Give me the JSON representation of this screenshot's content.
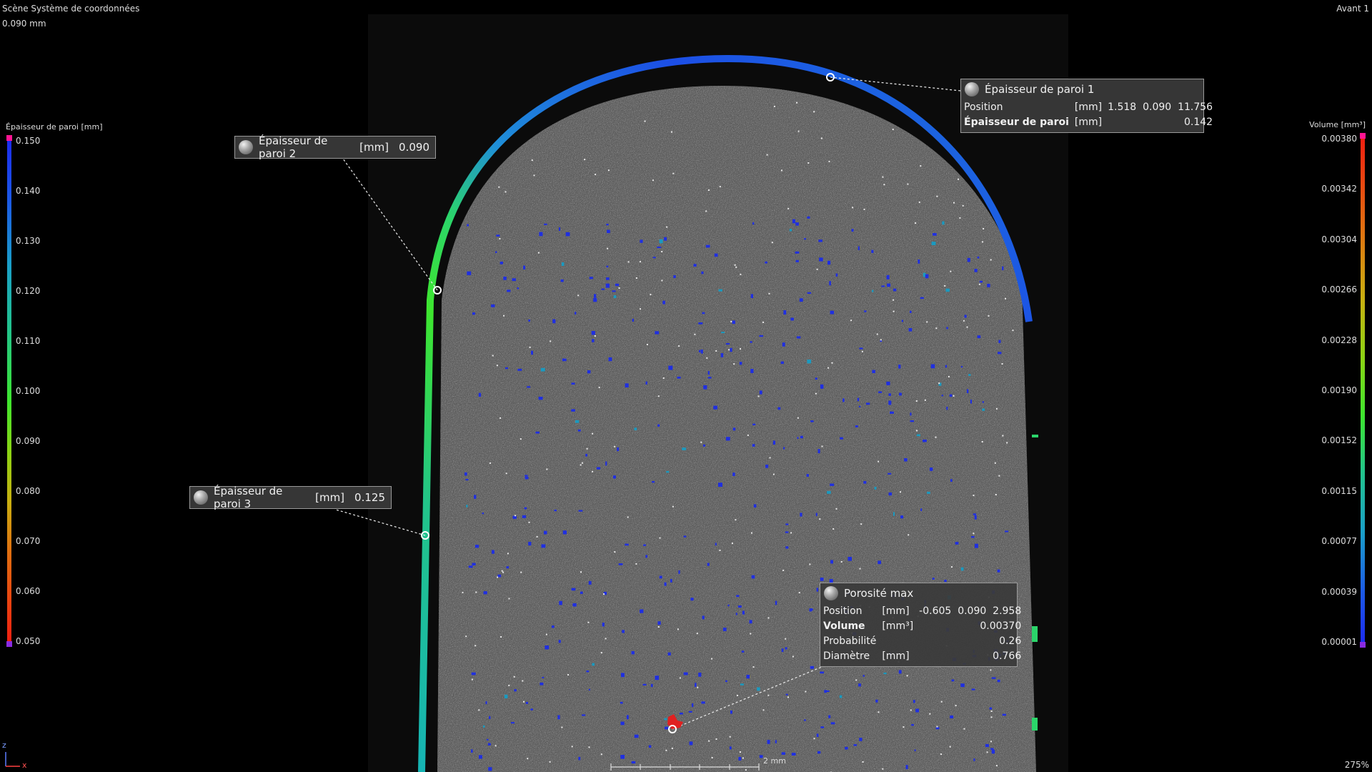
{
  "hud": {
    "scene_label": "Scène Système de coordonnées",
    "slice_value": "0.090 mm",
    "view_name": "Avant 1",
    "zoom": "275%",
    "scale_bar_label": "2 mm",
    "axis_z": "z",
    "axis_x": "x"
  },
  "left_scale": {
    "title": "Épaisseur de paroi [mm]",
    "ticks": [
      "0.150",
      "0.140",
      "0.130",
      "0.120",
      "0.110",
      "0.100",
      "0.090",
      "0.080",
      "0.070",
      "0.060",
      "0.050"
    ],
    "cap_top_color": "#ff1493",
    "cap_bottom_color": "#8a2be2"
  },
  "right_scale": {
    "title": "Volume [mm³]",
    "ticks": [
      "0.00380",
      "0.00342",
      "0.00304",
      "0.00266",
      "0.00228",
      "0.00190",
      "0.00152",
      "0.00115",
      "0.00077",
      "0.00039",
      "0.00001"
    ],
    "cap_top_color": "#ff1493",
    "cap_bottom_color": "#8a2be2"
  },
  "callouts": {
    "wall1": {
      "title": "Épaisseur de paroi 1",
      "row1_label": "Position",
      "row1_unit": "[mm]",
      "row1_value": "1.518  0.090  11.756",
      "row2_label": "Épaisseur de paroi",
      "row2_unit": "[mm]",
      "row2_value": "0.142"
    },
    "wall2": {
      "title": "Épaisseur de paroi 2",
      "unit": "[mm]",
      "value": "0.090"
    },
    "wall3": {
      "title": "Épaisseur de paroi 3",
      "unit": "[mm]",
      "value": "0.125"
    },
    "porosity": {
      "title": "Porosité max",
      "position_label": "Position",
      "position_unit": "[mm]",
      "position_value": "-0.605  0.090  2.958",
      "volume_label": "Volume",
      "volume_unit": "[mm³]",
      "volume_value": "0.00370",
      "prob_label": "Probabilité",
      "prob_value": "0.26",
      "diam_label": "Diamètre",
      "diam_unit": "[mm]",
      "diam_value": "0.766"
    }
  }
}
